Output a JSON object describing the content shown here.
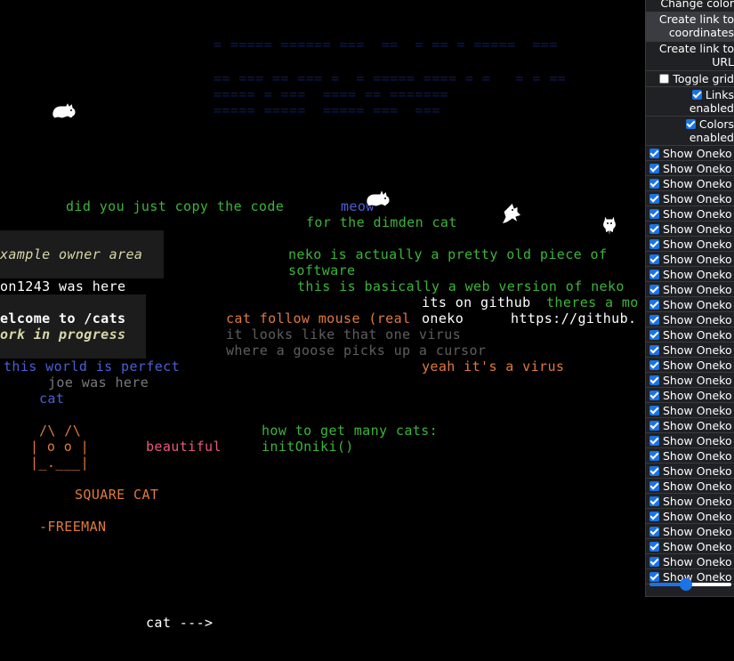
{
  "canvas_texts": [
    {
      "text": "did you just copy the code",
      "color": "#3cb43c"
    },
    {
      "text": "meow",
      "color": "#4b5fd6"
    },
    {
      "text": "for the dimden cat",
      "color": "#3cb43c"
    },
    {
      "text": "xample owner area",
      "color": "#d7d7a8"
    },
    {
      "text": "neko is actually a pretty old piece of",
      "color": "#3cb43c"
    },
    {
      "text": "software",
      "color": "#3cb43c"
    },
    {
      "text": "on1243 was here",
      "color": "#ffffff"
    },
    {
      "text": "this is basically a web version of neko",
      "color": "#3cb43c"
    },
    {
      "text": "its on github",
      "color": "#ffffff"
    },
    {
      "text": "theres a mo",
      "color": "#3cb43c"
    },
    {
      "text": "elcome to /cats",
      "color": "#ffffff"
    },
    {
      "text": "cat follow mouse (real",
      "color": "#e07a3c"
    },
    {
      "text": "oneko",
      "color": "#ffffff"
    },
    {
      "text": "https://github.",
      "color": "#ffffff"
    },
    {
      "text": "ork in progress",
      "color": "#d7d7a8"
    },
    {
      "text": "it looks like that one virus",
      "color": "#5e5e5e"
    },
    {
      "text": "where a goose picks up a cursor",
      "color": "#5e5e5e"
    },
    {
      "text": "this world is perfect",
      "color": "#4b5fd6"
    },
    {
      "text": "yeah it's a virus",
      "color": "#e07a3c"
    },
    {
      "text": "joe was here",
      "color": "#7a7a7a"
    },
    {
      "text": "cat",
      "color": "#4b5fd6"
    },
    {
      "text": "/\\ /\\",
      "color": "#e07a3c"
    },
    {
      "text": "| o o |",
      "color": "#e07a3c"
    },
    {
      "text": "|_.___|",
      "color": "#e07a3c"
    },
    {
      "text": "beautiful",
      "color": "#e85a7a"
    },
    {
      "text": "how to get many cats:",
      "color": "#3cb43c"
    },
    {
      "text": "initOniki()",
      "color": "#3cb43c"
    },
    {
      "text": "SQUARE CAT",
      "color": "#e07a3c"
    },
    {
      "text": "-FREEMAN",
      "color": "#e07a3c"
    },
    {
      "text": "cat --->",
      "color": "#ffffff"
    },
    {
      "text": "= ===== ====== ===  ==  = == = =====  ===",
      "color": "#0d1a5c"
    },
    {
      "text": "== === == === =  = ===== ==== = =   = = ==",
      "color": "#0d1a5c"
    },
    {
      "text": "===== = ===  ==== == =======",
      "color": "#0d1a5c"
    },
    {
      "text": "===== =====  ===== ===  ===",
      "color": "#0d1a5c"
    }
  ],
  "panel": {
    "change_color": "Change color",
    "create_link_coords": "Create link to coordinates",
    "create_link_url": "Create link to URL",
    "toggle_grid": "Toggle grid",
    "links_enabled": "Links enabled",
    "colors_enabled": "Colors enabled",
    "show_oneko_label": "Show Oneko",
    "oneko_count": 29,
    "slider_value": 0.45
  },
  "cats": [
    {
      "name": "cat-sprite-1"
    },
    {
      "name": "cat-sprite-2"
    },
    {
      "name": "cat-sprite-3"
    },
    {
      "name": "cat-sprite-4"
    }
  ]
}
